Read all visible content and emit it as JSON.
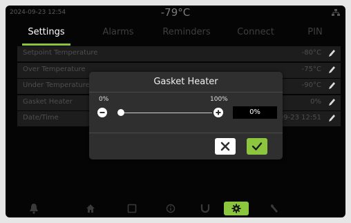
{
  "statusbar": {
    "datetime": "2024-09-23 12:54",
    "temperature": "-79°C",
    "network_icon": "network-icon"
  },
  "tabs": [
    {
      "label": "Settings",
      "active": true
    },
    {
      "label": "Alarms",
      "active": false
    },
    {
      "label": "Reminders",
      "active": false
    },
    {
      "label": "Connect",
      "active": false
    },
    {
      "label": "PIN",
      "active": false
    }
  ],
  "settings": {
    "rows": [
      {
        "label": "Setpoint Temperature",
        "value": "-80°C"
      },
      {
        "label": "Over Temperature",
        "value": "-75°C"
      },
      {
        "label": "Under Temperature",
        "value": "-90°C"
      },
      {
        "label": "Gasket Heater",
        "value": "0%"
      },
      {
        "label": "Date/Time",
        "value": "2024-09-23 12:51"
      }
    ],
    "edit_icon": "pencil-icon"
  },
  "dialog": {
    "title": "Gasket Heater",
    "min_label": "0%",
    "max_label": "100%",
    "value": "0%",
    "slider_fraction": 0,
    "cancel_icon": "close-icon",
    "confirm_icon": "checkmark-icon"
  },
  "navbar": {
    "items": [
      {
        "icon": "bell-icon"
      },
      {
        "icon": "home-icon"
      },
      {
        "icon": "square-icon"
      },
      {
        "icon": "info-icon"
      },
      {
        "icon": "magnet-icon"
      },
      {
        "icon": "gear-icon",
        "active": true
      },
      {
        "icon": "wrench-icon"
      }
    ]
  },
  "colors": {
    "accent": "#8cc63f",
    "background": "#050505",
    "dialog": "#2f2f2f",
    "cancel_button": "#ffffff",
    "confirm_button": "#8cc63f"
  }
}
